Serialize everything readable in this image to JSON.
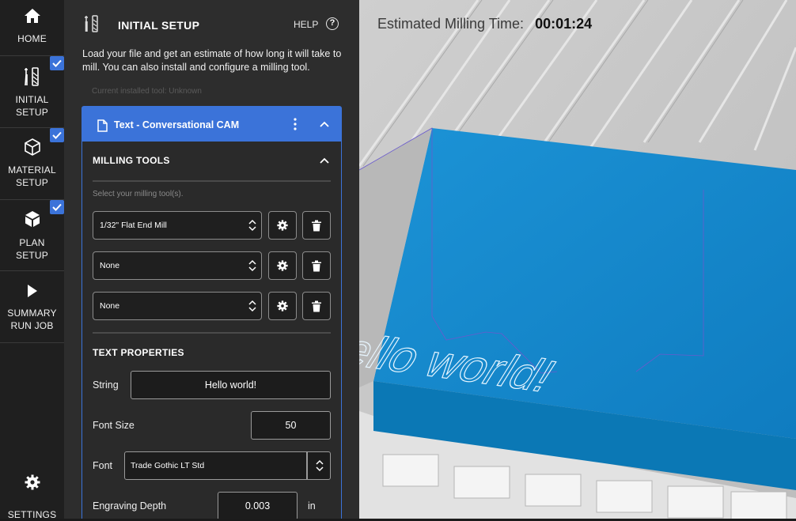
{
  "nav": {
    "items": [
      {
        "label1": "HOME",
        "label2": "",
        "checked": false
      },
      {
        "label1": "INITIAL",
        "label2": "SETUP",
        "checked": true
      },
      {
        "label1": "MATERIAL",
        "label2": "SETUP",
        "checked": true
      },
      {
        "label1": "PLAN",
        "label2": "SETUP",
        "checked": true
      },
      {
        "label1": "SUMMARY",
        "label2": "RUN JOB",
        "checked": false
      }
    ],
    "settings_label": "SETTINGS"
  },
  "panel": {
    "title": "INITIAL SETUP",
    "help_label": "HELP",
    "help_symbol": "?",
    "description": "Load your file and get an estimate of how long it will take to mill. You can also install and configure a milling tool.",
    "installed_tool": "Current installed tool: Unknown"
  },
  "card": {
    "title": "Text - Conversational CAM",
    "milling_tools": {
      "heading": "MILLING TOOLS",
      "hint": "Select your milling tool(s).",
      "tools": [
        "1/32\" Flat End Mill",
        "None",
        "None"
      ]
    },
    "text_properties": {
      "heading": "TEXT PROPERTIES",
      "string_label": "String",
      "string_value": "Hello world!",
      "font_size_label": "Font Size",
      "font_size_value": "50",
      "font_label": "Font",
      "font_value": "Trade Gothic LT Std",
      "depth_label": "Engraving Depth",
      "depth_value": "0.003",
      "depth_unit": "in"
    }
  },
  "viewport": {
    "estimate_label": "Estimated Milling Time:",
    "estimate_value": "00:01:24",
    "engraved_text": "Hello world!"
  },
  "colors": {
    "accent": "#3b73d9",
    "material": "#1a8fd0",
    "nav_bg": "#1f1f1f",
    "panel_bg": "#2d2d2d"
  }
}
